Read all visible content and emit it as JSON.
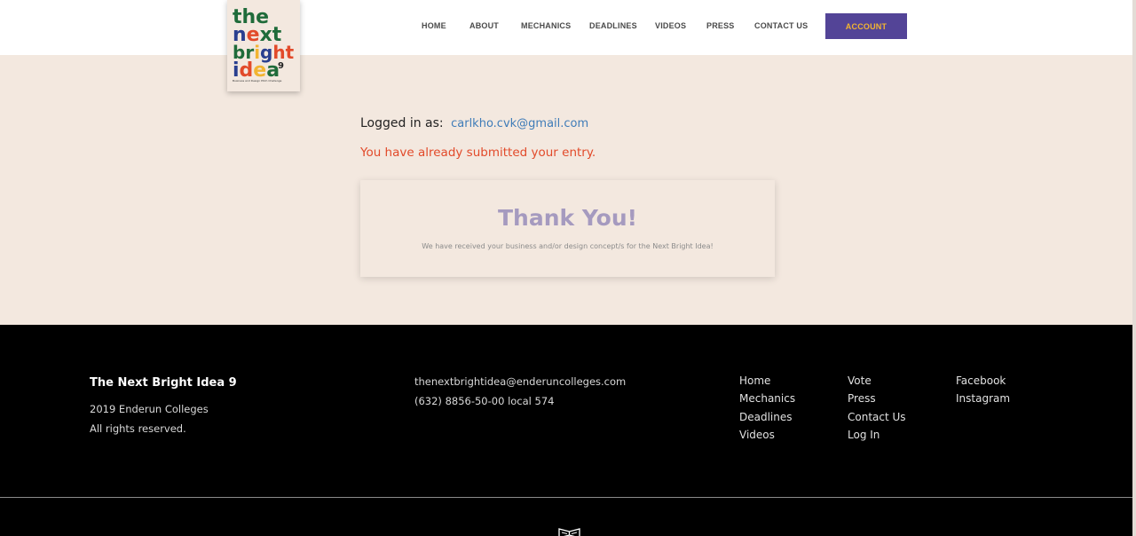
{
  "header": {
    "logo_lines": [
      "the",
      "next",
      "bright",
      "idea"
    ],
    "logo_number": "9",
    "logo_tagline": "Business and Design Pitch Challenge",
    "nav": [
      {
        "label": "HOME"
      },
      {
        "label": "ABOUT"
      },
      {
        "label": "MECHANICS"
      },
      {
        "label": "DEADLINES"
      },
      {
        "label": "VIDEOS"
      },
      {
        "label": "PRESS"
      },
      {
        "label": "CONTACT US"
      }
    ],
    "account_label": "ACCOUNT"
  },
  "main": {
    "logged_in_label": "Logged in as:",
    "user_email": "carlkho.cvk@gmail.com",
    "submitted_message": "You have already submitted your entry.",
    "card": {
      "title": "Thank You!",
      "message": "We have received your business and/or design concept/s for the Next Bright Idea!"
    }
  },
  "footer": {
    "brand": "The Next Bright Idea 9",
    "copyright_line1": "2019 Enderun Colleges",
    "copyright_line2": "All rights reserved.",
    "email": "thenextbrightidea@enderuncolleges.com",
    "phone": "(632) 8856-50-00 local 574",
    "links_col1": [
      "Home",
      "Mechanics",
      "Deadlines",
      "Videos"
    ],
    "links_col2": [
      "Vote",
      "Press",
      "Contact Us",
      "Log In"
    ],
    "links_col3": [
      "Facebook",
      "Instagram"
    ]
  },
  "colors": {
    "accent_purple": "#534497",
    "account_text": "#f2b431",
    "error_red": "#e24a2a",
    "link_blue": "#3f7cb8",
    "page_bg": "#f3e8df"
  }
}
